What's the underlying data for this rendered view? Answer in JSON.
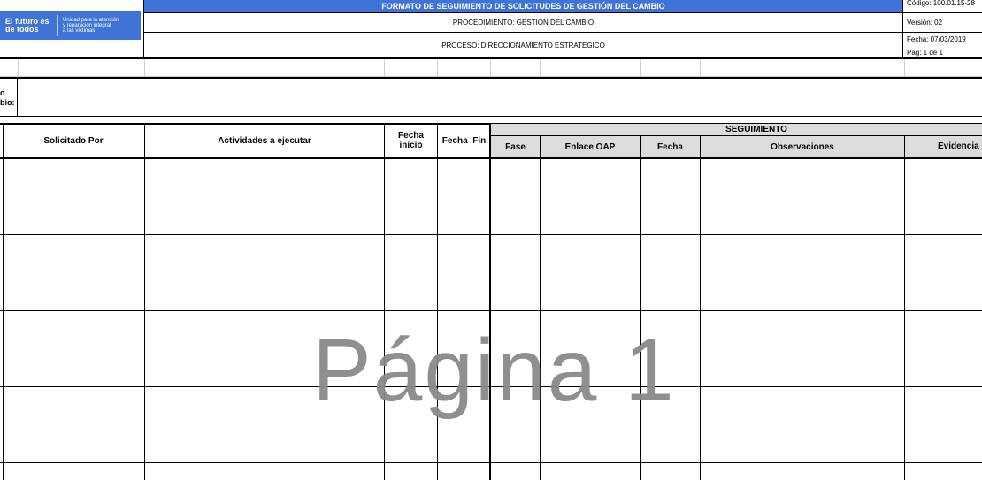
{
  "header": {
    "logo": {
      "main": "El futuro es de todos",
      "tagline_1": "Unidad para la atención",
      "tagline_2": "y reparación integral",
      "tagline_3": "a las víctimas"
    },
    "title": "FORMATO DE SEGUIMIENTO DE SOLICITUDES DE GESTIÓN DEL CAMBIO",
    "procedimiento": "PROCEDIMIENTO: GESTIÓN DEL CAMBIO",
    "proceso": "PROCESO: DIRECCIONAMIENTO ESTRATEGICO",
    "codigo": "Código: 100.01.15-28",
    "version": "Versión: 02",
    "fecha": "Fecha: 07/03/2019",
    "pagina": "Pag: 1 de 1"
  },
  "form": {
    "partial_label_1": "o",
    "partial_label_2": "bio:"
  },
  "table": {
    "headers": {
      "solicitado_por": "Solicitado Por",
      "actividades": "Actividades a ejecutar",
      "fecha_inicio_1": "Fecha",
      "fecha_inicio_2": "inicio",
      "fecha_fin": "Fecha  Fin",
      "seguimiento": "SEGUIMIENTO",
      "fase": "Fase",
      "enlace_oap": "Enlace OAP",
      "fecha": "Fecha",
      "observaciones": "Observaciones",
      "evidencia": "Evidencia"
    }
  },
  "watermark": "Página 1",
  "colors": {
    "header_blue": "#3f73d6",
    "subheader_gray": "#dcdcdc",
    "watermark_gray": "#8a8a8a"
  }
}
